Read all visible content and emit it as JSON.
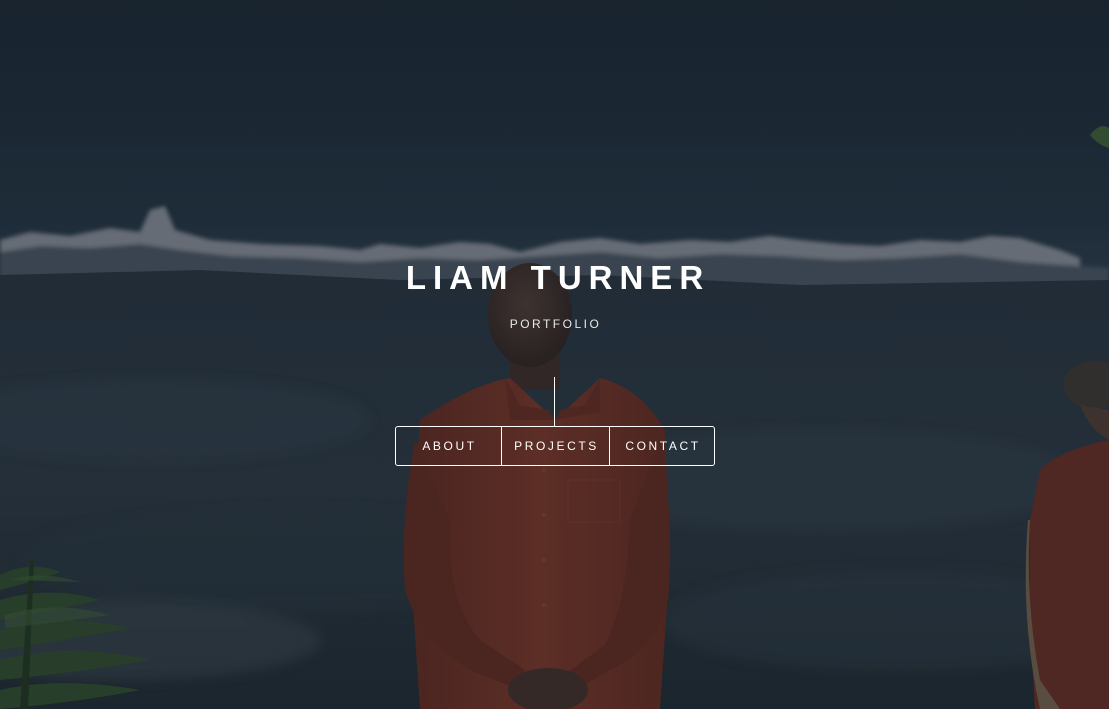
{
  "header": {
    "title": "LIAM TURNER",
    "subtitle": "PORTFOLIO"
  },
  "nav": {
    "items": [
      {
        "label": "ABOUT"
      },
      {
        "label": "PROJECTS"
      },
      {
        "label": "CONTACT"
      }
    ]
  },
  "colors": {
    "text": "#ffffff",
    "sky": "#1e2d3a",
    "shirt": "#6e3328"
  }
}
